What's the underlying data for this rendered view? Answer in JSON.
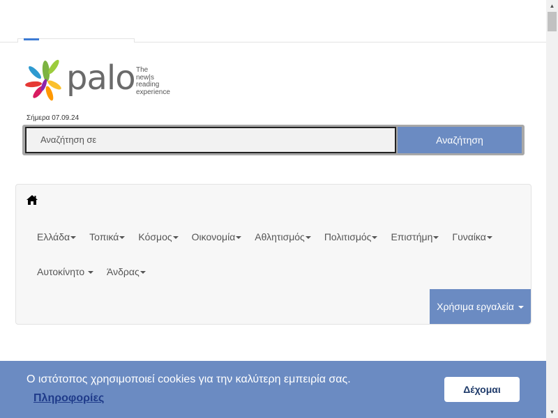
{
  "logo": {
    "wordmark": "palo",
    "tagline_line1": "The",
    "tagline_line2": "new|s",
    "tagline_line3": "reading",
    "tagline_line4": "experience"
  },
  "date_line": "Σήμερα 07.09.24",
  "search": {
    "placeholder": " Αναζήτηση σε",
    "button_label": "Αναζήτηση"
  },
  "nav": {
    "home_icon": "home-icon",
    "row1": [
      {
        "label": "Ελλάδα"
      },
      {
        "label": "Τοπικά"
      },
      {
        "label": "Κόσμος"
      },
      {
        "label": "Οικονομία"
      },
      {
        "label": "Αθλητισμός"
      },
      {
        "label": "Πολιτισμός"
      },
      {
        "label": "Επιστήμη"
      },
      {
        "label": "Γυναίκα"
      }
    ],
    "row2": [
      {
        "label": "Αυτοκίνητο"
      },
      {
        "label": "Άνδρας"
      }
    ],
    "tools_label": "Χρήσιμα εργαλεία"
  },
  "cookie": {
    "message": "Ο ιστότοπος χρησιμοποιεί cookies για την καλύτερη εμπειρία σας.",
    "more_link": "Πληροφορίες",
    "accept_label": "Δέχομαι"
  },
  "colors": {
    "accent": "#6b8bc2",
    "link_dark": "#1f3b8a"
  }
}
